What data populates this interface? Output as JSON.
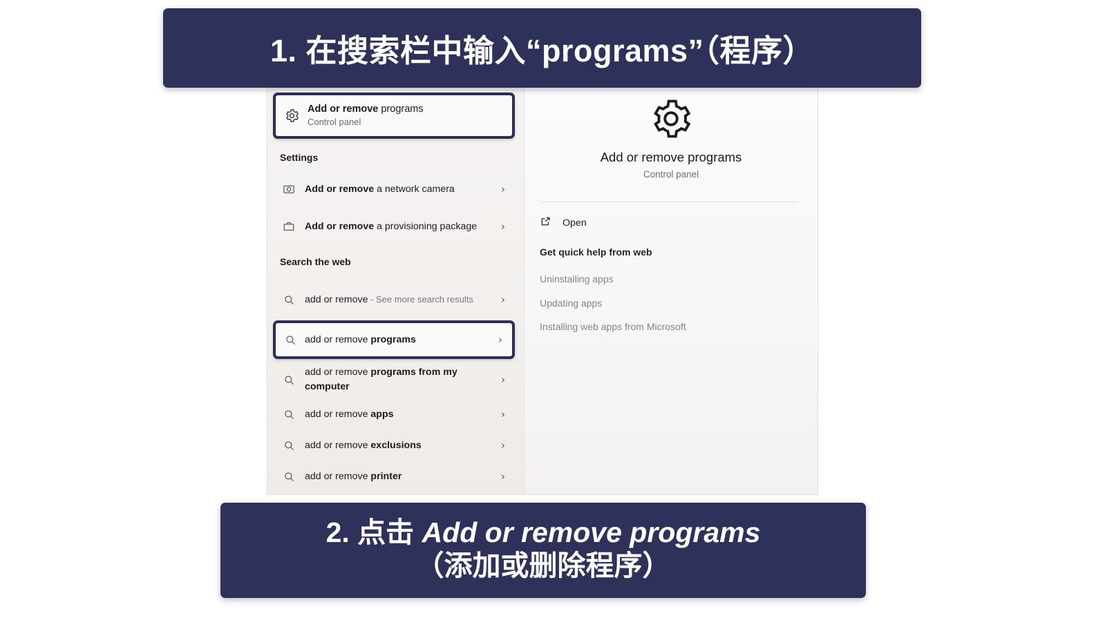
{
  "banners": {
    "top": {
      "text": "1.  在搜索栏中输入“programs”（程序）"
    },
    "bottom": {
      "line1_prefix": "2. 点击 ",
      "line1_en": "Add or remove programs",
      "line2": "（添加或删除程序）"
    }
  },
  "accent_color": "#2e3159",
  "search_panel": {
    "best_match": {
      "icon": "gear-icon",
      "title_bold": "Add or remove",
      "title_rest": " programs",
      "subtitle": "Control panel"
    },
    "settings_section": {
      "header": "Settings",
      "items": [
        {
          "icon": "camera-icon",
          "bold": "Add or remove",
          "rest": " a network camera",
          "chevron": "›"
        },
        {
          "icon": "package-icon",
          "bold": "Add or remove",
          "rest": " a provisioning package",
          "chevron": "›"
        }
      ]
    },
    "web_section": {
      "header": "Search the web",
      "items": [
        {
          "icon": "search-icon",
          "regular": "add or remove",
          "muted": " - See more search results",
          "chevron": "›",
          "selected": false
        },
        {
          "icon": "search-icon",
          "regular": "add or remove ",
          "bold": "programs",
          "chevron": "›",
          "selected": true
        },
        {
          "icon": "search-icon",
          "regular": "add or remove ",
          "bold": "programs from my computer",
          "chevron": "›",
          "selected": false
        },
        {
          "icon": "search-icon",
          "regular": "add or remove ",
          "bold": "apps",
          "chevron": "›",
          "selected": false
        },
        {
          "icon": "search-icon",
          "regular": "add or remove ",
          "bold": "exclusions",
          "chevron": "›",
          "selected": false
        },
        {
          "icon": "search-icon",
          "regular": "add or remove ",
          "bold": "printer",
          "chevron": "›",
          "selected": false
        }
      ]
    },
    "preview": {
      "icon": "gear-icon",
      "title": "Add or remove programs",
      "subtitle": "Control panel",
      "open_label": "Open",
      "open_icon": "external-link-icon",
      "help_heading": "Get quick help from web",
      "help_links": [
        "Uninstalling apps",
        "Updating apps",
        "Installing web apps from Microsoft"
      ]
    }
  }
}
